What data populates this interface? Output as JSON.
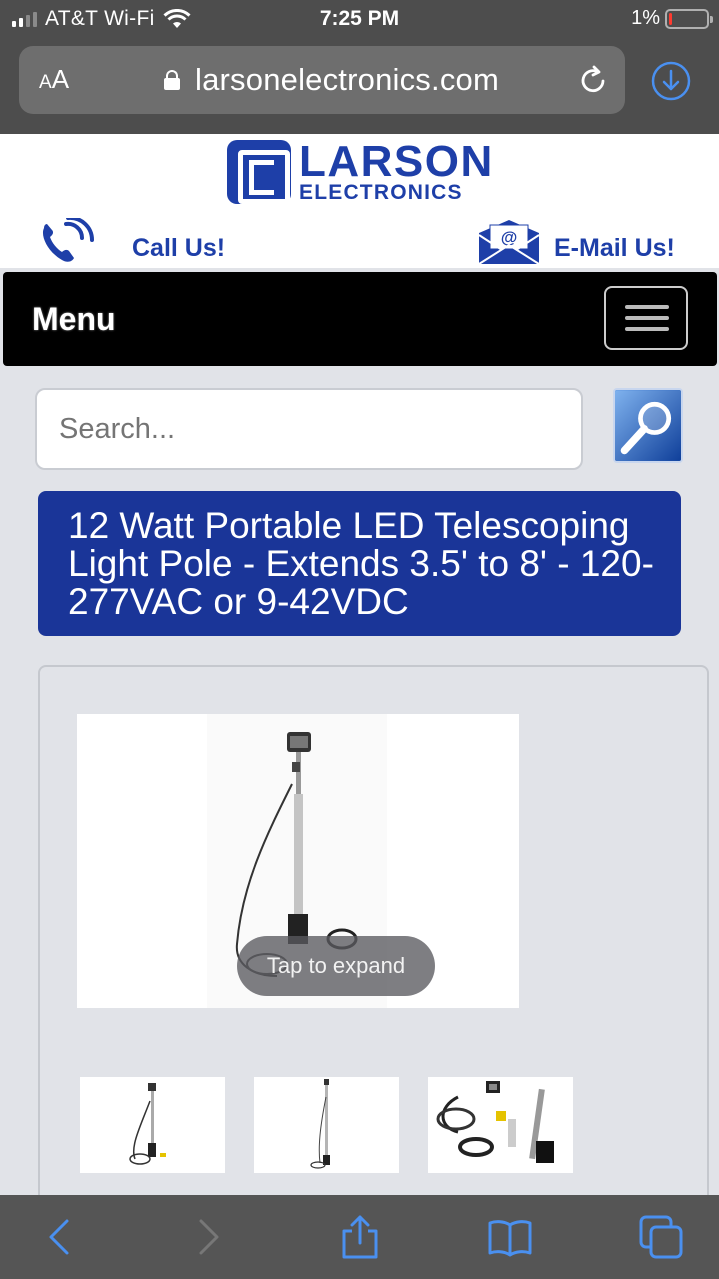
{
  "status_bar": {
    "carrier": "AT&T Wi-Fi",
    "time": "7:25 PM",
    "battery_percent": "1%",
    "battery_level": 0.01
  },
  "safari": {
    "text_size_label": "AA",
    "domain": "larsonelectronics.com"
  },
  "site_header": {
    "logo_line1": "LARSON",
    "logo_line2": "ELECTRONICS",
    "call_label": "Call Us!",
    "email_label": "E-Mail Us!",
    "menu_label": "Menu"
  },
  "search": {
    "placeholder": "Search..."
  },
  "product": {
    "title": "12 Watt Portable LED Telescoping Light Pole - Extends 3.5' to 8' - 120-277VAC or 9-42VDC",
    "tap_to_expand": "Tap to expand"
  },
  "colors": {
    "brand_blue": "#1a3598",
    "menu_bg": "#000000",
    "safari_accent": "#4a90f0"
  }
}
